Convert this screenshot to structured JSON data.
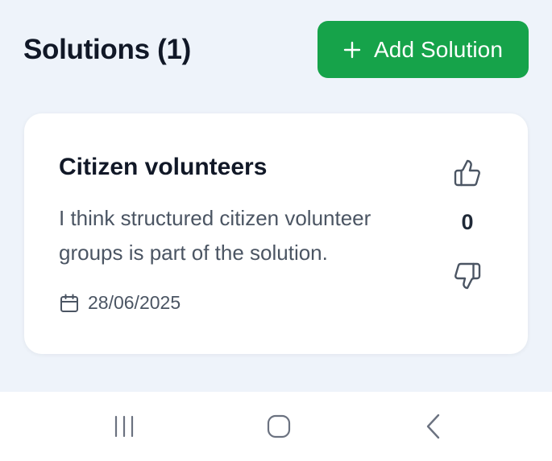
{
  "header": {
    "title": "Solutions (1)",
    "add_button_label": "Add Solution",
    "add_button_icon": "plus-icon"
  },
  "solutions": [
    {
      "title": "Citizen volunteers",
      "description": "I think structured citizen volunteer groups is part of the solution.",
      "date": "28/06/2025",
      "votes": "0",
      "upvote_icon": "thumbs-up-icon",
      "downvote_icon": "thumbs-down-icon",
      "date_icon": "calendar-icon"
    }
  ],
  "system_nav": {
    "recents_icon": "recent-apps-icon",
    "home_icon": "home-icon",
    "back_icon": "back-icon"
  },
  "colors": {
    "background": "#eef3fa",
    "accent": "#16a34a",
    "card": "#ffffff",
    "text_primary": "#111827",
    "text_secondary": "#4b5563"
  }
}
